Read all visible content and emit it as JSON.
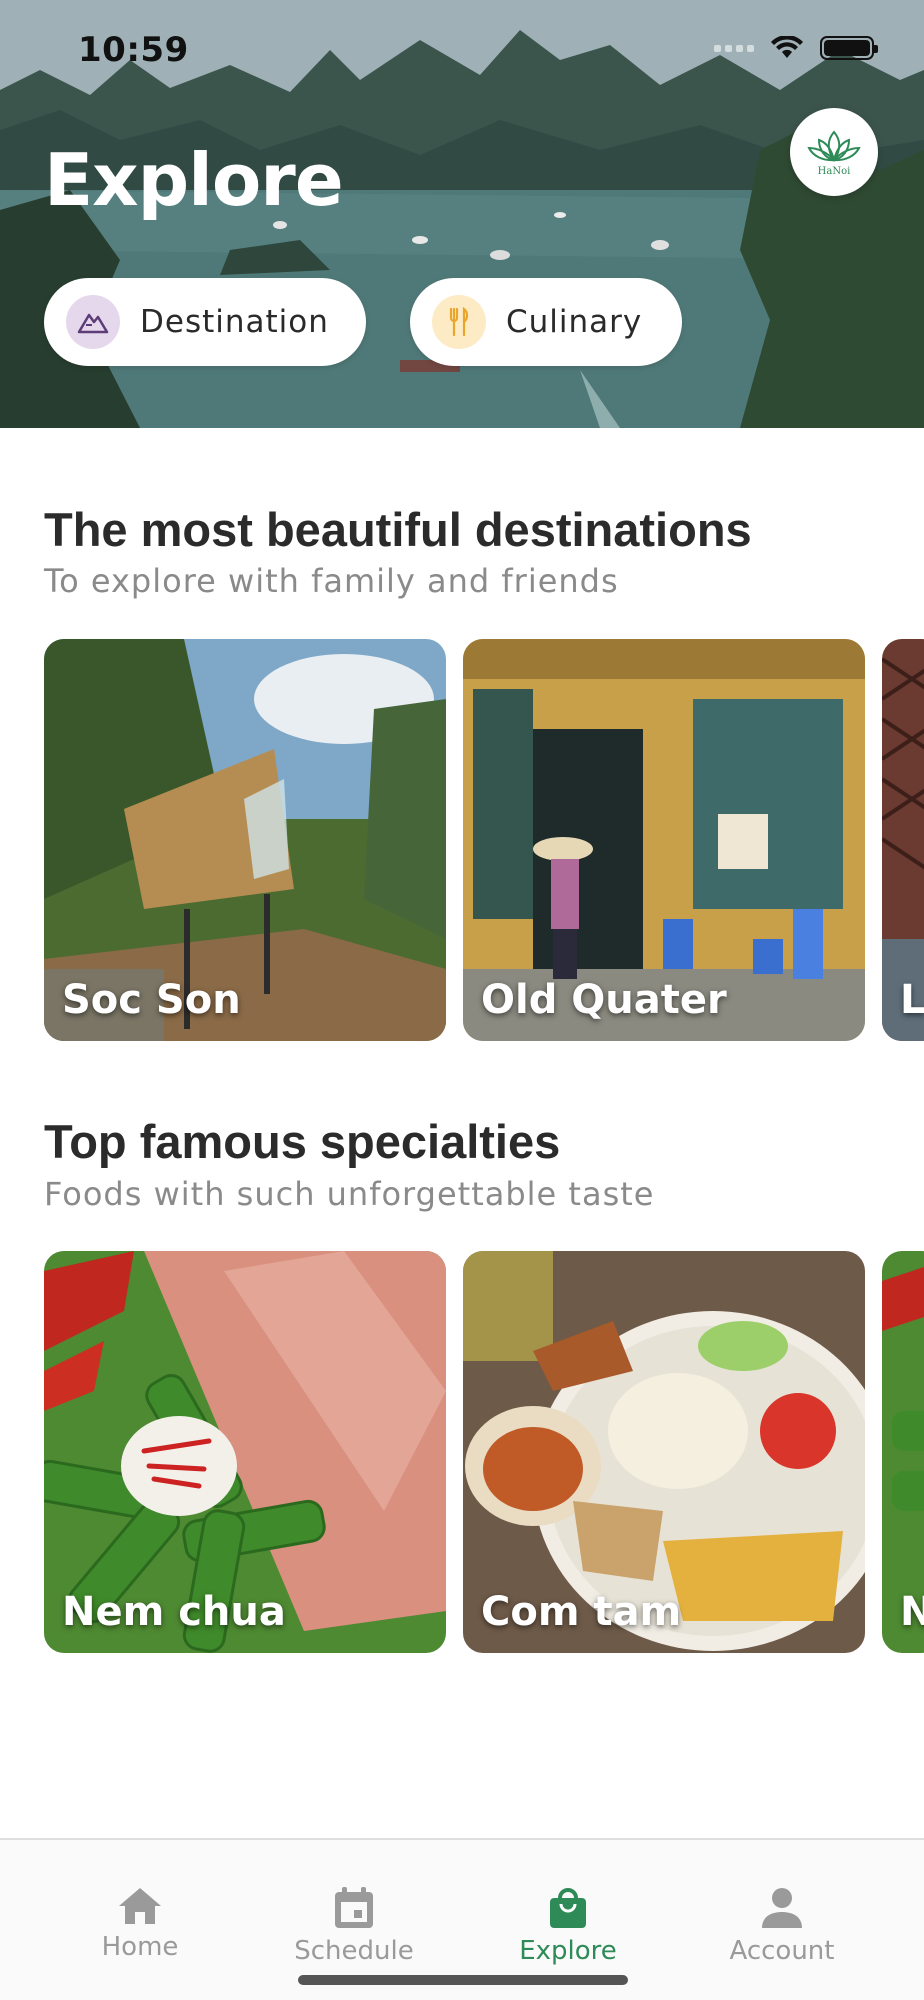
{
  "status_bar": {
    "time": "10:59"
  },
  "hero": {
    "title": "Explore",
    "logo_text": "HaNoi",
    "chips": [
      {
        "label": "Destination",
        "icon": "mountain-icon"
      },
      {
        "label": "Culinary",
        "icon": "utensils-icon"
      }
    ]
  },
  "destinations": {
    "title": "The most beautiful destinations",
    "subtitle": "To explore with family and friends",
    "cards": [
      {
        "label": "Soc Son"
      },
      {
        "label": "Old Quater"
      },
      {
        "label": "L"
      }
    ]
  },
  "specialties": {
    "title": "Top famous specialties",
    "subtitle": "Foods with such unforgettable taste",
    "cards": [
      {
        "label": "Nem chua"
      },
      {
        "label": "Com tam"
      },
      {
        "label": "N"
      }
    ]
  },
  "bottom_nav": {
    "items": [
      {
        "label": "Home",
        "icon": "home-icon",
        "active": false
      },
      {
        "label": "Schedule",
        "icon": "calendar-icon",
        "active": false
      },
      {
        "label": "Explore",
        "icon": "shopping-bag-icon",
        "active": true
      },
      {
        "label": "Account",
        "icon": "person-icon",
        "active": false
      }
    ]
  },
  "colors": {
    "accent": "#2e8b57",
    "inactive": "#9a9a9a",
    "title": "#2b2b2b",
    "subtitle": "#8a8a8a"
  }
}
